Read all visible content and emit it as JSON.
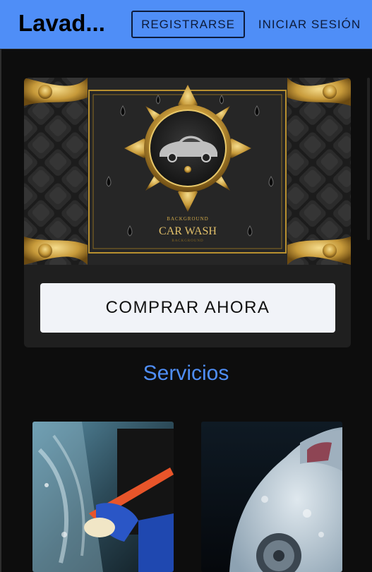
{
  "header": {
    "brand": "Lavad...",
    "register_label": "REGISTRARSE",
    "login_label": "INICIAR SESIÓN",
    "bg_color": "#4f8ef7"
  },
  "hero": {
    "image_caption_small": "BACKGROUND",
    "image_caption": "CAR WASH",
    "image_caption_sub": "BACKGROUND",
    "buy_button_label": "COMPRAR AHORA"
  },
  "services": {
    "title": "Servicios",
    "items": [
      {
        "image": "interior-cleaning-photo"
      },
      {
        "image": "foam-wash-photo"
      }
    ]
  }
}
